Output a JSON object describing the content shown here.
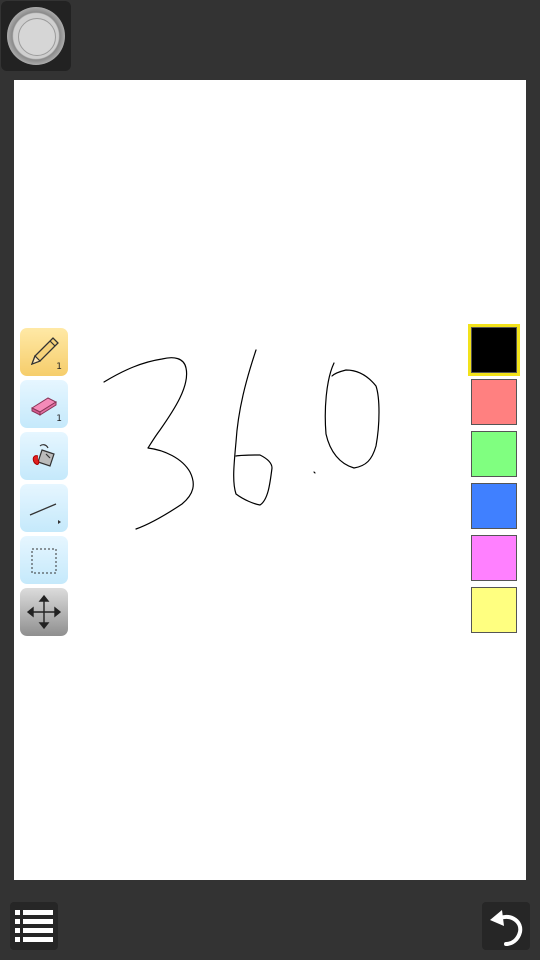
{
  "top_bar": {
    "menu_orb_icon": "circle-menu-icon"
  },
  "tools": [
    {
      "name": "pencil-tool",
      "icon": "pencil-icon",
      "size_label": "1",
      "active": true
    },
    {
      "name": "eraser-tool",
      "icon": "eraser-icon",
      "size_label": "1",
      "active": false
    },
    {
      "name": "fill-tool",
      "icon": "paint-bucket-icon",
      "size_label": "",
      "active": false
    },
    {
      "name": "line-tool",
      "icon": "line-icon",
      "size_label": "",
      "active": false
    },
    {
      "name": "select-tool",
      "icon": "dotted-rectangle-icon",
      "size_label": "",
      "active": false
    },
    {
      "name": "move-tool",
      "icon": "move-arrows-icon",
      "size_label": "",
      "active": false
    }
  ],
  "colors": [
    {
      "hex": "#000000",
      "selected": true
    },
    {
      "hex": "#ff8080",
      "selected": false
    },
    {
      "hex": "#80ff80",
      "selected": false
    },
    {
      "hex": "#4080ff",
      "selected": false
    },
    {
      "hex": "#ff80ff",
      "selected": false
    },
    {
      "hex": "#ffff80",
      "selected": false
    }
  ],
  "theme": {
    "background": "#333333",
    "canvas": "#ffffff",
    "selection_border": "#f2e21a"
  },
  "bottom_bar": {
    "list_icon": "list-icon",
    "undo_icon": "undo-icon"
  }
}
